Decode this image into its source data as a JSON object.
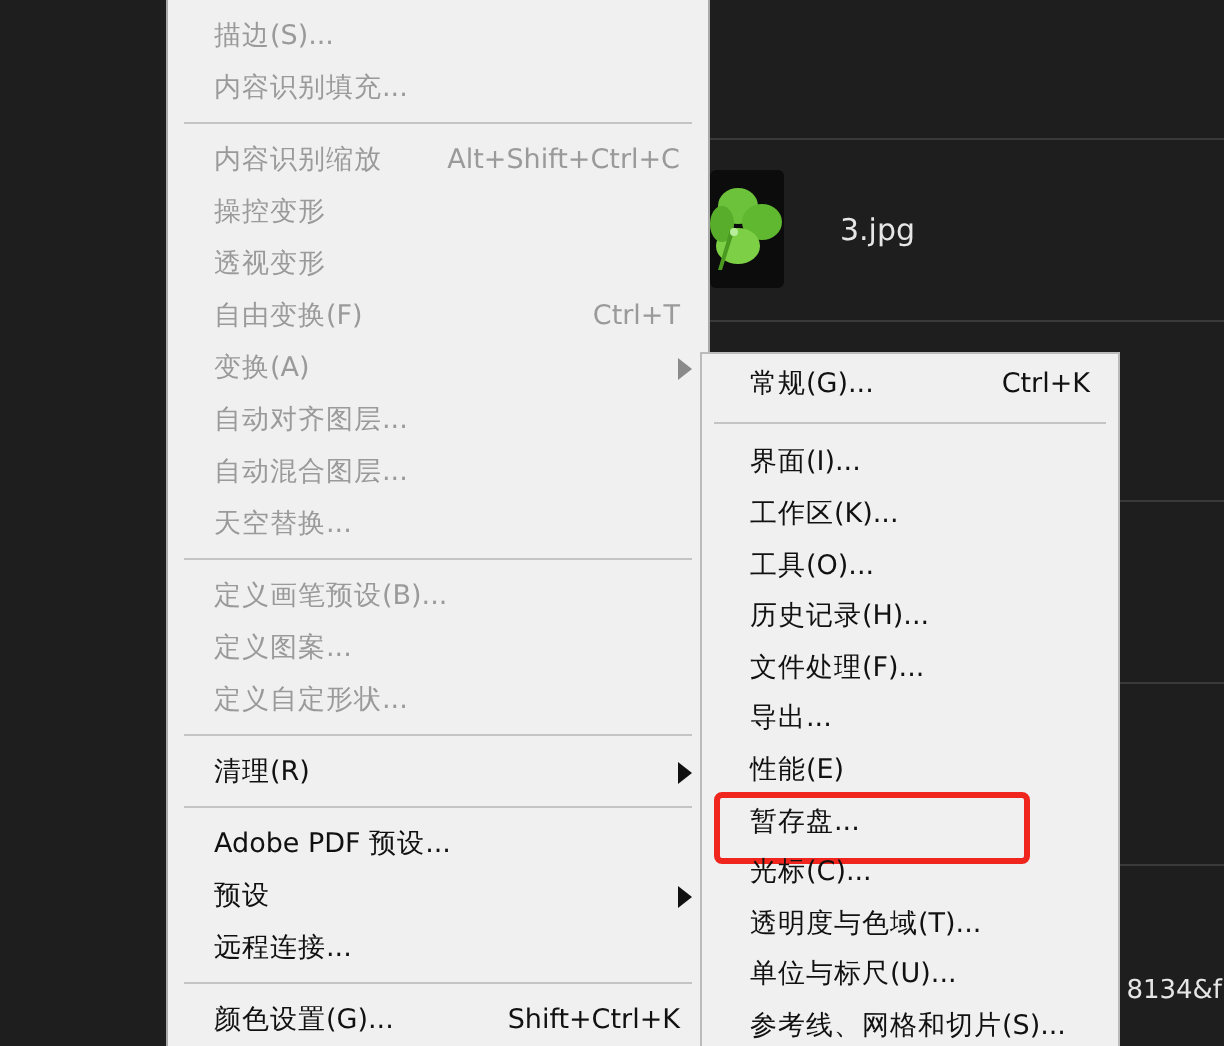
{
  "file_list": {
    "items": [
      {
        "kind": "picture",
        "name": "3.jpg"
      },
      {
        "kind": "text",
        "name": "8134&f"
      }
    ]
  },
  "edit_menu": {
    "items": [
      {
        "kind": "item",
        "label": "描边(S)...",
        "disabled": true
      },
      {
        "kind": "item",
        "label": "内容识别填充...",
        "disabled": true
      },
      {
        "kind": "separator"
      },
      {
        "kind": "item",
        "label": "内容识别缩放",
        "shortcut": "Alt+Shift+Ctrl+C",
        "disabled": true
      },
      {
        "kind": "item",
        "label": "操控变形",
        "disabled": true
      },
      {
        "kind": "item",
        "label": "透视变形",
        "disabled": true
      },
      {
        "kind": "item",
        "label": "自由变换(F)",
        "shortcut": "Ctrl+T",
        "disabled": true
      },
      {
        "kind": "item",
        "label": "变换(A)",
        "disabled": true,
        "has_submenu": true
      },
      {
        "kind": "item",
        "label": "自动对齐图层...",
        "disabled": true
      },
      {
        "kind": "item",
        "label": "自动混合图层...",
        "disabled": true
      },
      {
        "kind": "item",
        "label": "天空替换...",
        "disabled": true
      },
      {
        "kind": "separator"
      },
      {
        "kind": "item",
        "label": "定义画笔预设(B)...",
        "disabled": true
      },
      {
        "kind": "item",
        "label": "定义图案...",
        "disabled": true
      },
      {
        "kind": "item",
        "label": "定义自定形状...",
        "disabled": true
      },
      {
        "kind": "separator"
      },
      {
        "kind": "item",
        "label": "清理(R)",
        "disabled": false,
        "has_submenu": true
      },
      {
        "kind": "separator"
      },
      {
        "kind": "item",
        "label": "Adobe PDF 预设...",
        "disabled": false
      },
      {
        "kind": "item",
        "label": "预设",
        "disabled": false,
        "has_submenu": true
      },
      {
        "kind": "item",
        "label": "远程连接...",
        "disabled": false
      },
      {
        "kind": "separator"
      },
      {
        "kind": "item",
        "label": "颜色设置(G)...",
        "shortcut": "Shift+Ctrl+K",
        "disabled": false
      }
    ]
  },
  "preferences_submenu": {
    "items": [
      {
        "kind": "item",
        "label": "常规(G)...",
        "shortcut": "Ctrl+K",
        "highlighted": false
      },
      {
        "kind": "separator"
      },
      {
        "kind": "item",
        "label": "界面(I)...",
        "highlighted": false
      },
      {
        "kind": "item",
        "label": "工作区(K)...",
        "highlighted": false
      },
      {
        "kind": "item",
        "label": "工具(O)...",
        "highlighted": false
      },
      {
        "kind": "item",
        "label": "历史记录(H)...",
        "highlighted": false
      },
      {
        "kind": "item",
        "label": "文件处理(F)...",
        "highlighted": false
      },
      {
        "kind": "item",
        "label": "导出...",
        "highlighted": false
      },
      {
        "kind": "item",
        "label": "性能(E)",
        "highlighted": false
      },
      {
        "kind": "item",
        "label": "暂存盘...",
        "highlighted": true
      },
      {
        "kind": "item",
        "label": "光标(C)...",
        "highlighted": false
      },
      {
        "kind": "item",
        "label": "透明度与色域(T)...",
        "highlighted": false
      },
      {
        "kind": "item",
        "label": "单位与标尺(U)...",
        "highlighted": false
      },
      {
        "kind": "item",
        "label": "参考线、网格和切片(S)...",
        "highlighted": false
      }
    ]
  }
}
